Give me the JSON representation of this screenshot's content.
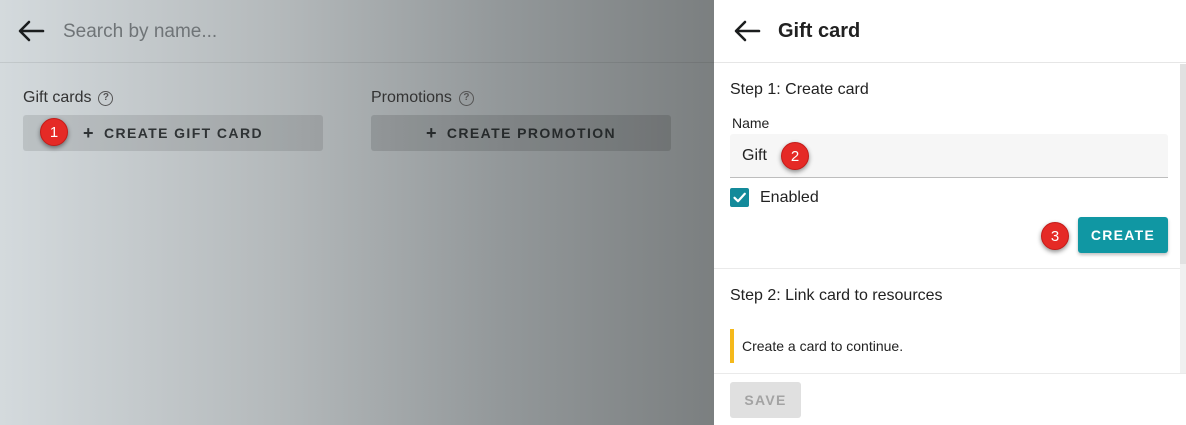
{
  "background": {
    "search": {
      "placeholder": "Search by name..."
    },
    "sections": {
      "gift_cards": {
        "title": "Gift cards",
        "button_label": "CREATE GIFT CARD"
      },
      "promotions": {
        "title": "Promotions",
        "button_label": "CREATE PROMOTION"
      }
    }
  },
  "markers": {
    "one": "1",
    "two": "2",
    "three": "3"
  },
  "drawer": {
    "title": "Gift card",
    "step1": {
      "title": "Step 1: Create card",
      "name_label": "Name",
      "name_value": "Gift",
      "enabled_label": "Enabled",
      "enabled_checked": true,
      "create_label": "CREATE"
    },
    "step2": {
      "title": "Step 2: Link card to resources",
      "info": "Create a card to continue."
    },
    "footer": {
      "save_label": "SAVE"
    }
  },
  "colors": {
    "accent": "#1097a3",
    "checkbox": "#138a9a",
    "marker": "#e52a26",
    "warning_bar": "#f5b91b"
  },
  "icons": {
    "back": "arrow-left-icon",
    "help": "help-circle-icon",
    "plus": "plus-icon",
    "check": "check-icon"
  }
}
